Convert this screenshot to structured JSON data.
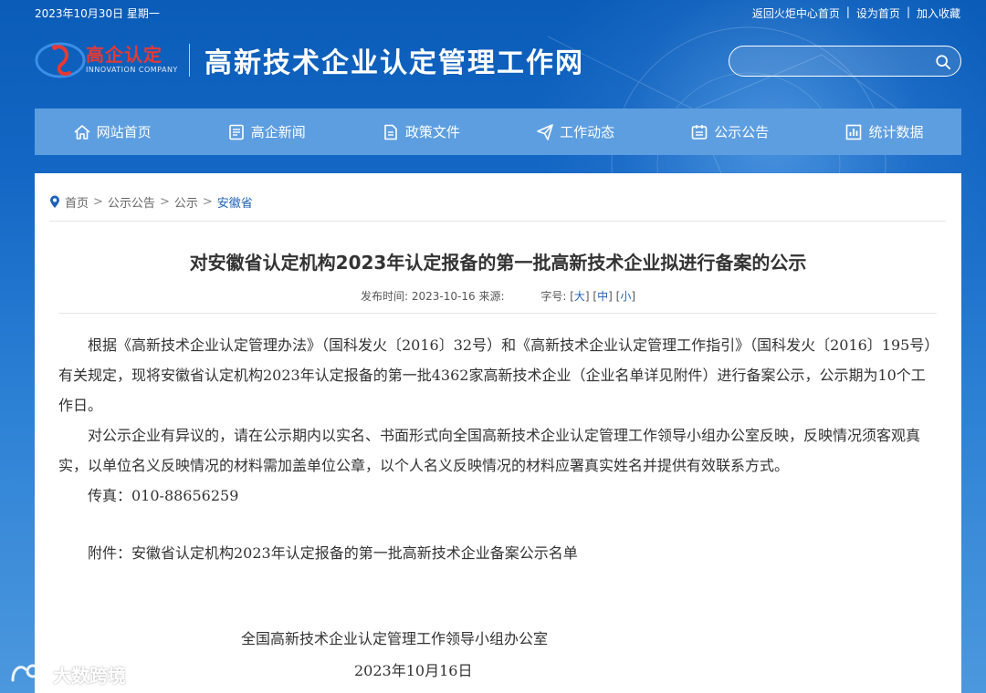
{
  "topbar": {
    "date": "2023年10月30日 星期一",
    "links": [
      "返回火炬中心首页",
      "设为首页",
      "加入收藏"
    ]
  },
  "header": {
    "logo_text": "高企认定",
    "logo_sub": "INNOVATION COMPANY",
    "site_title": "高新技术企业认定管理工作网",
    "search_placeholder": ""
  },
  "nav": {
    "items": [
      {
        "label": "网站首页",
        "icon": "home-icon"
      },
      {
        "label": "高企新闻",
        "icon": "news-icon"
      },
      {
        "label": "政策文件",
        "icon": "document-icon"
      },
      {
        "label": "工作动态",
        "icon": "paper-plane-icon"
      },
      {
        "label": "公示公告",
        "icon": "notice-icon"
      },
      {
        "label": "统计数据",
        "icon": "chart-icon"
      }
    ]
  },
  "breadcrumb": [
    "首页",
    "公示公告",
    "公示",
    "安徽省"
  ],
  "article": {
    "title": "对安徽省认定机构2023年认定报备的第一批高新技术企业拟进行备案的公示",
    "publish_label": "发布时间:",
    "publish_date": "2023-10-16",
    "source_label": "来源:",
    "font_size_label": "字号:",
    "font_sizes": [
      "大",
      "中",
      "小"
    ],
    "paragraphs": [
      "根据《高新技术企业认定管理办法》（国科发火〔2016〕32号）和《高新技术企业认定管理工作指引》（国科发火〔2016〕195号）有关规定，现将安徽省认定机构2023年认定报备的第一批4362家高新技术企业（企业名单详见附件）进行备案公示，公示期为10个工作日。",
      "对公示企业有异议的，请在公示期内以实名、书面形式向全国高新技术企业认定管理工作领导小组办公室反映，反映情况须客观真实，以单位名义反映情况的材料需加盖单位公章，以个人名义反映情况的材料应署真实姓名并提供有效联系方式。",
      "传真：010-88656259"
    ],
    "attachment": "附件：安徽省认定机构2023年认定报备的第一批高新技术企业备案公示名单",
    "signature_org": "全国高新技术企业认定管理工作领导小组办公室",
    "signature_date": "2023年10月16日"
  },
  "watermark": "大数跨境"
}
